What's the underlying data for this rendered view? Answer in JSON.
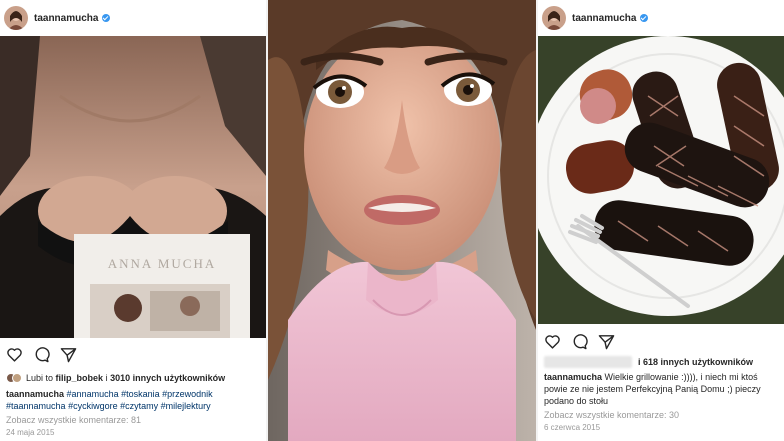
{
  "colors": {
    "verified": "#3897f0",
    "hashtag": "#003569",
    "muted": "#999999"
  },
  "left_post": {
    "username": "taannamucha",
    "book_title": "ANNA MUCHA",
    "likes": {
      "prefix": "Lubi to",
      "user": "filip_bobek",
      "and": "i",
      "count": "3010 innych użytkowników"
    },
    "caption_user": "taannamucha",
    "hashtags": [
      "#annamucha",
      "#toskania",
      "#przewodnik",
      "#taannamucha",
      "#cyckiwgore",
      "#czytamy",
      "#milejlektury"
    ],
    "comments_link": "Zobacz wszystkie komentarze: 81",
    "date": "24 maja 2015"
  },
  "right_post": {
    "username": "taannamucha",
    "likes": "i 618 innych użytkowników",
    "caption_user": "taannamucha",
    "caption_text": "Wielkie grillowanie :)))), i niech mi ktoś powie ze nie jestem Perfekcyjną Panią Domu ;) pieczy podano do stołu",
    "comments_link": "Zobacz wszystkie komentarze: 30",
    "date": "6 czerwca 2015"
  },
  "icons": [
    "heart-icon",
    "comment-icon",
    "share-icon",
    "verified-icon"
  ]
}
